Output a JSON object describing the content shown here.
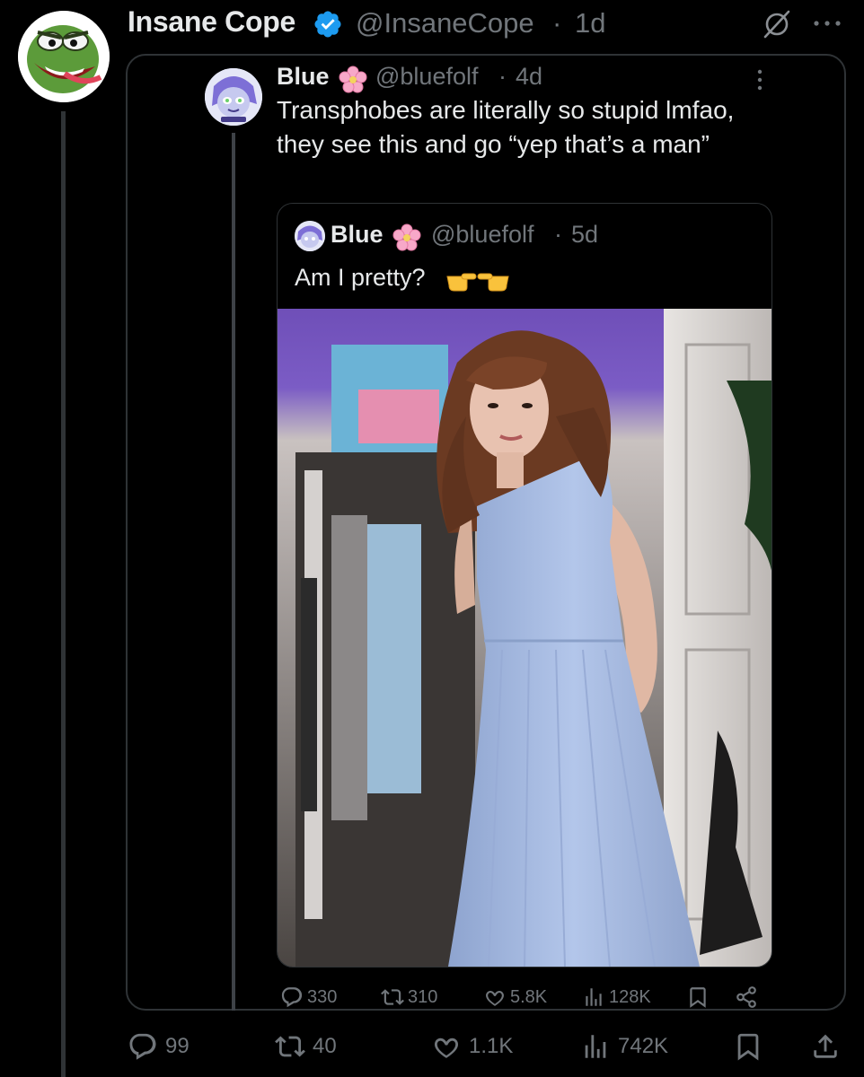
{
  "outer_tweet": {
    "author_name": "Insane Cope",
    "handle": "@InsaneCope",
    "separator": "·",
    "time": "1d",
    "avatar_icon": "angry-pepe-avatar",
    "verified_icon": "verified-badge-icon",
    "grok_icon": "grok-icon",
    "more_icon": "more-horizontal-icon",
    "actions": {
      "replies": "99",
      "reposts": "40",
      "likes": "1.1K",
      "views": "742K"
    }
  },
  "quoted_tweet": {
    "author_name": "Blue",
    "emoji_icon": "cherry-blossom-icon",
    "handle": "@bluefolf",
    "separator": "·",
    "time": "4d",
    "text": "Transphobes are literally so stupid lmfao, they see this and go “yep that’s a man”",
    "more_icon": "more-vertical-icon",
    "actions": {
      "replies": "330",
      "reposts": "310",
      "likes": "5.8K",
      "views": "128K"
    }
  },
  "nested_tweet": {
    "author_name": "Blue",
    "emoji_icon": "cherry-blossom-icon",
    "handle": "@bluefolf",
    "separator": "·",
    "time": "5d",
    "text": "Am I pretty?",
    "trailing_emoji": "pointing-hands-emoji",
    "photo": "person-in-light-blue-dress-photo"
  },
  "colors": {
    "background": "#000000",
    "text_primary": "#e7e9ea",
    "text_secondary": "#71767b",
    "border": "#2f3336",
    "verified_blue": "#1d9bf0",
    "blossom_pink": "#f7a8c8"
  }
}
